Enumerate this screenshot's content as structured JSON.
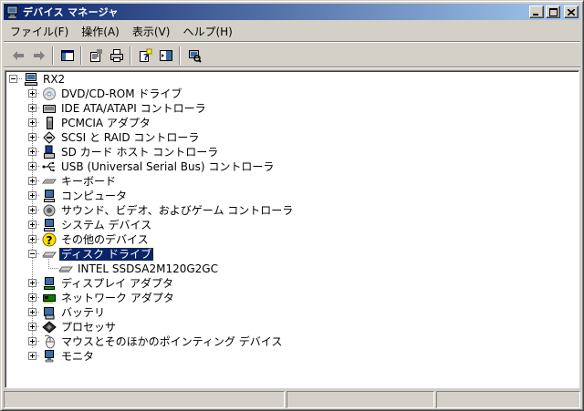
{
  "window": {
    "title": "デバイス マネージャ",
    "controls": {
      "minimize": "minimize",
      "maximize": "maximize",
      "close": "close"
    }
  },
  "menu": [
    {
      "label": "ファイル(F)"
    },
    {
      "label": "操作(A)"
    },
    {
      "label": "表示(V)"
    },
    {
      "label": "ヘルプ(H)"
    }
  ],
  "toolbar": {
    "buttons": [
      "back-arrow-icon",
      "forward-arrow-icon",
      "show-hide-tree-icon",
      "properties-icon",
      "print-icon",
      "help-icon",
      "export-list-icon",
      "scan-hardware-icon"
    ]
  },
  "tree": {
    "root": {
      "label": "RX2",
      "icon": "computer-icon",
      "expanded": true
    },
    "items": [
      {
        "label": "DVD/CD-ROM ドライブ",
        "icon": "dvd-drive-icon",
        "expanded": false
      },
      {
        "label": "IDE ATA/ATAPI コントローラ",
        "icon": "ide-controller-icon",
        "expanded": false
      },
      {
        "label": "PCMCIA アダプタ",
        "icon": "pcmcia-icon",
        "expanded": false
      },
      {
        "label": "SCSI と RAID コントローラ",
        "icon": "scsi-icon",
        "expanded": false
      },
      {
        "label": "SD カード ホスト コントローラ",
        "icon": "sd-host-icon",
        "expanded": false
      },
      {
        "label": "USB (Universal Serial Bus) コントローラ",
        "icon": "usb-icon",
        "expanded": false
      },
      {
        "label": "キーボード",
        "icon": "keyboard-icon",
        "expanded": false
      },
      {
        "label": "コンピュータ",
        "icon": "monitor-computer-icon",
        "expanded": false
      },
      {
        "label": "サウンド、ビデオ、およびゲーム コントローラ",
        "icon": "sound-icon",
        "expanded": false
      },
      {
        "label": "システム デバイス",
        "icon": "system-device-icon",
        "expanded": false
      },
      {
        "label": "その他のデバイス",
        "icon": "unknown-device-icon",
        "expanded": false
      },
      {
        "label": "ディスク ドライブ",
        "icon": "disk-drive-icon",
        "expanded": true,
        "selected": true,
        "children": [
          {
            "label": "INTEL SSDSA2M120G2GC",
            "icon": "disk-drive-icon"
          }
        ]
      },
      {
        "label": "ディスプレイ アダプタ",
        "icon": "display-adapter-icon",
        "expanded": false
      },
      {
        "label": "ネットワーク アダプタ",
        "icon": "network-adapter-icon",
        "expanded": false
      },
      {
        "label": "バッテリ",
        "icon": "battery-icon",
        "expanded": false
      },
      {
        "label": "プロセッサ",
        "icon": "processor-icon",
        "expanded": false
      },
      {
        "label": "マウスとそのほかのポインティング デバイス",
        "icon": "mouse-icon",
        "expanded": false
      },
      {
        "label": "モニタ",
        "icon": "monitor-icon",
        "expanded": false
      }
    ]
  },
  "colors": {
    "titlebar_start": "#0a246a",
    "titlebar_end": "#a6caf0",
    "selection": "#0a246a",
    "face": "#d4d0c8"
  }
}
